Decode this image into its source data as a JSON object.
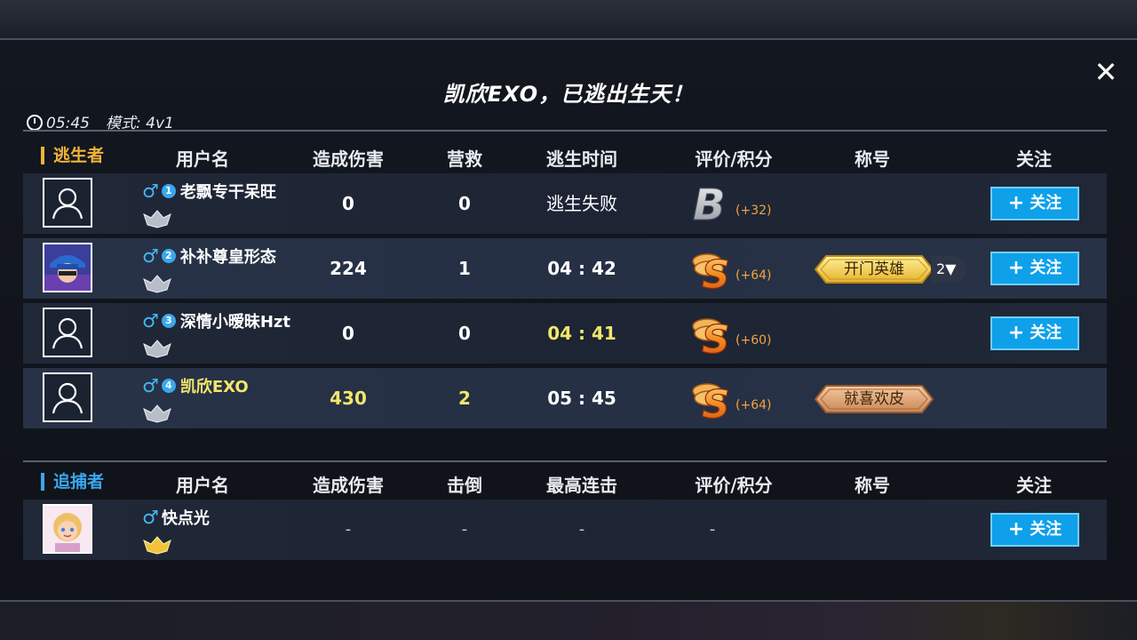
{
  "title": "凯欣EXO，已逃出生天！",
  "close_label": "✕",
  "meta": {
    "time": "05:45",
    "mode": "模式: 4v1"
  },
  "survivors": {
    "section_label": "逃生者",
    "section_color": "#f0b43a",
    "headers": [
      "用户名",
      "造成伤害",
      "营救",
      "逃生时间",
      "评价/积分",
      "称号",
      "关注"
    ],
    "rows": [
      {
        "seat": "1",
        "gender": "♂",
        "name": "老飘专干呆旺",
        "damage": "0",
        "rescue": "0",
        "escape_time": "逃生失败",
        "grade": "B",
        "points": "(+32)",
        "title": "",
        "follow": "关注"
      },
      {
        "seat": "2",
        "gender": "♂",
        "name": "补补尊皇形态",
        "damage": "224",
        "rescue": "1",
        "escape_time": "04 : 42",
        "grade": "S",
        "points": "(+64)",
        "title": "开门英雄",
        "title_more": "2▼",
        "follow": "关注"
      },
      {
        "seat": "3",
        "gender": "♂",
        "name": "深情小暧昧Hzt",
        "damage": "0",
        "rescue": "0",
        "escape_time": "04 : 41",
        "grade": "S",
        "points": "(+60)",
        "title": "",
        "follow": "关注"
      },
      {
        "seat": "4",
        "gender": "♂",
        "name": "凯欣EXO",
        "damage": "430",
        "rescue": "2",
        "escape_time": "05 : 45",
        "grade": "S",
        "points": "(+64)",
        "title": "就喜欢皮",
        "follow": ""
      }
    ]
  },
  "hunters": {
    "section_label": "追捕者",
    "section_color": "#3aa7ef",
    "headers": [
      "用户名",
      "造成伤害",
      "击倒",
      "最高连击",
      "评价/积分",
      "称号",
      "关注"
    ],
    "rows": [
      {
        "gender": "♂",
        "name": "快点光",
        "damage": "-",
        "knockdowns": "-",
        "max_combo": "-",
        "grade": "-",
        "follow": "关注"
      }
    ]
  },
  "follow_plus": "+"
}
